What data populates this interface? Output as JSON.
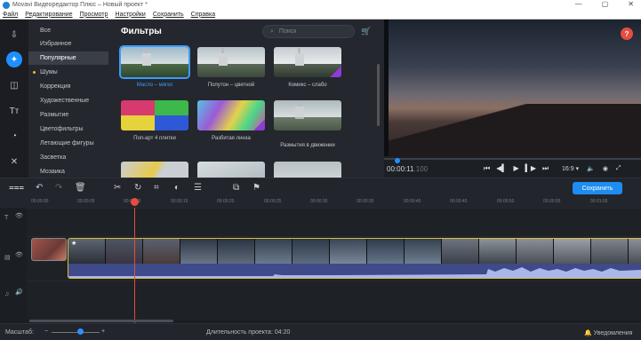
{
  "window": {
    "title": "Movavi Видеоредактор Плюс – Новый проект *",
    "controls": [
      "—",
      "▢",
      "✕"
    ]
  },
  "menu": [
    "Файл",
    "Редактирование",
    "Просмотр",
    "Настройки",
    "Сохранить",
    "Справка"
  ],
  "tools": [
    "import-icon",
    "filters-icon",
    "transitions-icon",
    "titles-icon",
    "stickers-icon",
    "more-tools-icon"
  ],
  "categories": [
    {
      "label": "Все"
    },
    {
      "label": "Избранное"
    },
    {
      "label": "Популярные"
    },
    {
      "label": "Шумы"
    },
    {
      "label": "Коррекция"
    },
    {
      "label": "Художественные"
    },
    {
      "label": "Размытие"
    },
    {
      "label": "Цветофильтры"
    },
    {
      "label": "Летающие фигуры"
    },
    {
      "label": "Засветка"
    },
    {
      "label": "Мозаика"
    }
  ],
  "filters": {
    "title": "Фильтры",
    "search_placeholder": "Поиск",
    "items": [
      {
        "label": "Масло – мягко"
      },
      {
        "label": "Полутон – цветной"
      },
      {
        "label": "Комикс – слабо"
      },
      {
        "label": "Поп-арт 4 плитки"
      },
      {
        "label": "Разбитая линза"
      },
      {
        "label": "Размытия в движении"
      },
      {
        "label": ""
      },
      {
        "label": ""
      },
      {
        "label": ""
      }
    ]
  },
  "preview": {
    "time_main": "00:00:11",
    "time_frames": ".100",
    "aspect": "16:9 ▾",
    "help": "?"
  },
  "toolbar": {
    "save_label": "Сохранить"
  },
  "ruler": [
    "00:00:00",
    "00:00:05",
    "00:00:10",
    "00:00:15",
    "00:00:20",
    "00:00:25",
    "00:00:30",
    "00:00:35",
    "00:00:40",
    "00:00:45",
    "00:00:50",
    "00:00:55",
    "00:01:00"
  ],
  "status": {
    "zoom_label": "Масштаб:",
    "duration": "Длительность проекта: 04:20",
    "notifications": "Уведомления"
  },
  "colors": {
    "accent": "#1e8cf0",
    "playhead": "#e74c3c",
    "clip_border": "#e0bf3c"
  }
}
